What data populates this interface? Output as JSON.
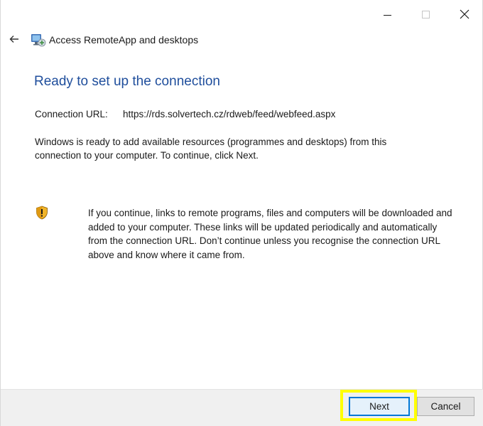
{
  "window": {
    "title": "Access RemoteApp and desktops",
    "controls": {
      "minimize_icon": "minimize-icon",
      "maximize_icon": "maximize-icon",
      "close_icon": "close-icon"
    }
  },
  "nav": {
    "back_icon": "back-arrow-icon",
    "app_icon": "remoteapp-icon"
  },
  "page": {
    "heading": "Ready to set up the connection",
    "connection_url_label": "Connection URL:",
    "connection_url": "https://rds.solvertech.cz/rdweb/feed/webfeed.aspx",
    "intro": "Windows is ready to add available resources (programmes and desktops) from this connection to your computer. To continue, click Next.",
    "warning_icon": "shield-warning-icon",
    "warning": "If you continue, links to remote programs, files and computers will be downloaded and added to your computer. These links will be updated periodically and automatically from the connection URL. Don’t continue unless you recognise the connection URL above and know where it came from."
  },
  "footer": {
    "next_label": "Next",
    "cancel_label": "Cancel"
  },
  "colors": {
    "heading": "#1f4e9c",
    "accent_border": "#0078d7",
    "highlight": "#ffff00",
    "footer_bg": "#f0f0f0"
  }
}
